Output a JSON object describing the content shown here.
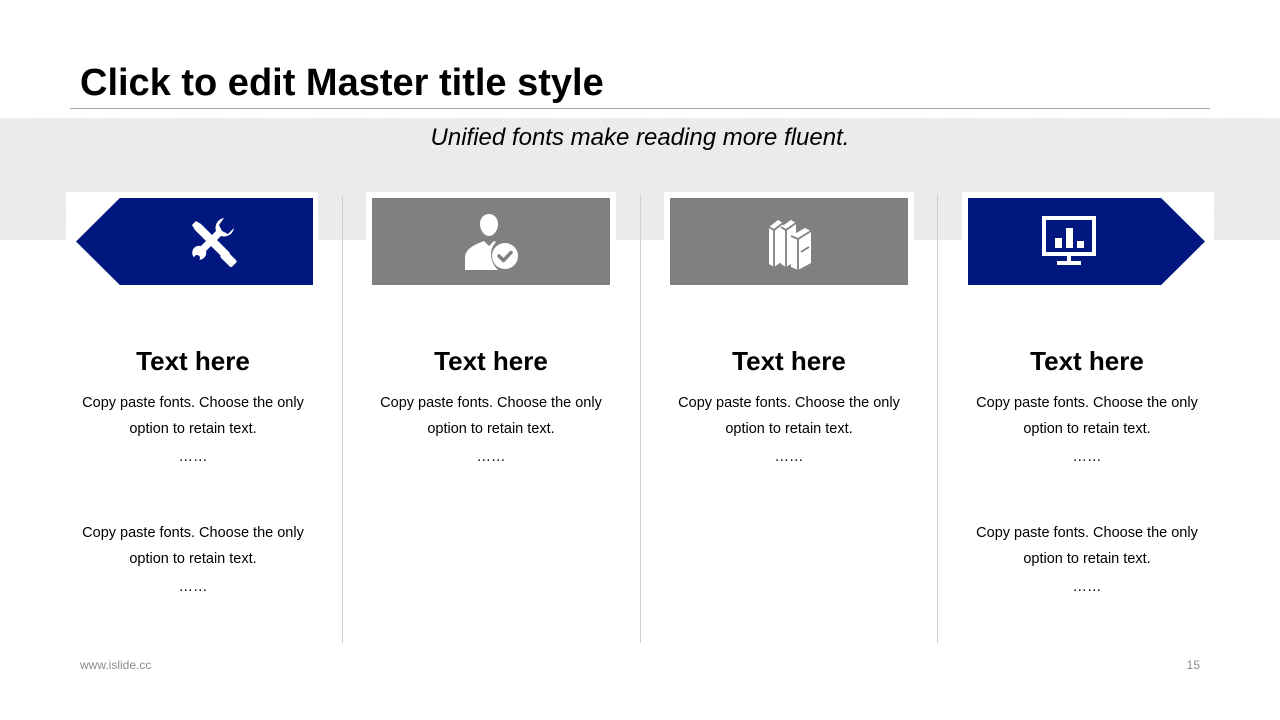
{
  "slide": {
    "title": "Click to edit Master title style",
    "subtitle": "Unified fonts make reading more fluent."
  },
  "theme": {
    "accent_blue": "#00177F",
    "accent_gray": "#808080",
    "band_gray": "#EEEEEE"
  },
  "columns": [
    {
      "icon": "tools-icon",
      "heading": "Text here",
      "paragraphs": [
        {
          "line1": "Copy paste fonts. Choose the only",
          "line2": "option to retain text.",
          "dots": "……"
        },
        {
          "line1": "Copy paste fonts. Choose the only",
          "line2": "option to retain text.",
          "dots": "……"
        }
      ]
    },
    {
      "icon": "user-check-icon",
      "heading": "Text here",
      "paragraphs": [
        {
          "line1": "Copy paste fonts. Choose the only",
          "line2": "option to retain text.",
          "dots": "……"
        }
      ]
    },
    {
      "icon": "books-icon",
      "heading": "Text here",
      "paragraphs": [
        {
          "line1": "Copy paste fonts. Choose the only",
          "line2": "option to retain text.",
          "dots": "……"
        }
      ]
    },
    {
      "icon": "presentation-chart-icon",
      "heading": "Text here",
      "paragraphs": [
        {
          "line1": "Copy paste fonts. Choose the only",
          "line2": "option to retain text.",
          "dots": "……"
        },
        {
          "line1": "Copy paste fonts. Choose the only",
          "line2": "option to retain text.",
          "dots": "……"
        }
      ]
    }
  ],
  "footer": {
    "website": "www.islide.cc",
    "page_number": "15"
  }
}
